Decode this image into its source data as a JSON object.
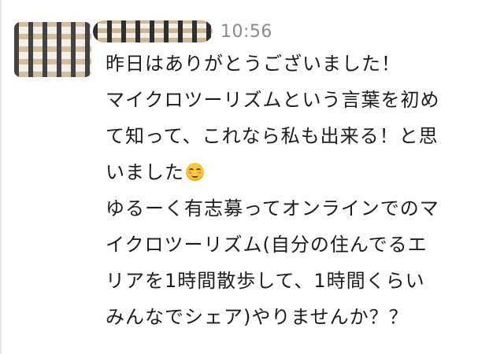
{
  "message": {
    "sender_name": "",
    "timestamp": "10:56",
    "lines": [
      "昨日はありがとうございました！",
      "マイクロツーリズムという言葉を初め",
      "て知って、これなら私も出来る！と思",
      "いました",
      "ゆるーく有志募ってオンラインでのマ",
      "イクロツーリズム(自分の住んでるエ",
      "リアを1時間散歩して、1時間くらい",
      "みんなでシェア)やりませんか？？"
    ],
    "emoji_icon": "smiling-face-with-smiling-eyes-icon"
  },
  "colors": {
    "timestamp": "#8a8a8a",
    "text": "#1d1c1d",
    "background": "#ffffff"
  }
}
